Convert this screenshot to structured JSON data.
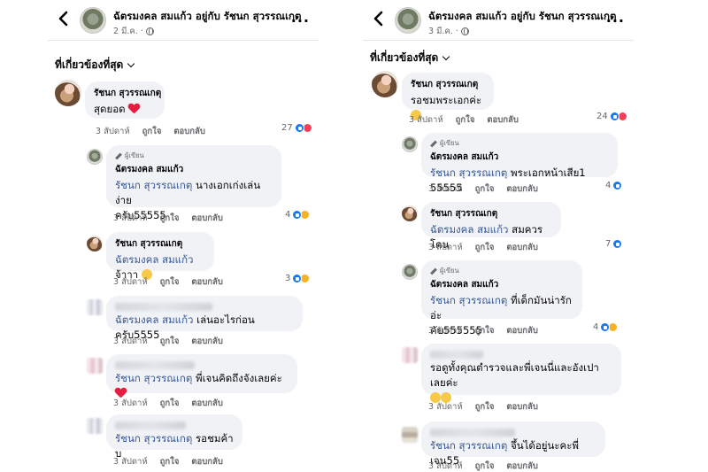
{
  "left": {
    "post": {
      "title": "ฉัตรมงคล สมแก้ว อยู่กับ รัชนก สุวรรณเกตุ",
      "meta": "2 มี.ค. ·"
    },
    "filter_label": "ที่เกี่ยวข้องที่สุด",
    "comments": [
      {
        "name": "รัชนก สุวรรณเกตุ",
        "text": "สุดยอด",
        "time": "3 สัปดาห์",
        "like": "ถูกใจ",
        "reply": "ตอบกลับ",
        "reaction_count": "27"
      },
      {
        "badge": "ผู้เขียน",
        "name": "ฉัตรมงคล สมแก้ว",
        "mention": "รัชนก สุวรรณเกตุ",
        "text": "นางเอกเก่งเล่นง่าย",
        "text2": "ครับ55555",
        "time": "3 สัปดาห์",
        "like": "ถูกใจ",
        "reply": "ตอบกลับ",
        "reaction_count": "4"
      },
      {
        "name": "รัชนก สุวรรณเกตุ",
        "mention": "ฉัตรมงคล สมแก้ว",
        "text": "จ้าาา",
        "time": "3 สัปดาห์",
        "like": "ถูกใจ",
        "reply": "ตอบกลับ",
        "reaction_count": "3"
      },
      {
        "mention": "ฉัตรมงคล สมแก้ว",
        "text": "เล่นอะไรก่อนครับ5555",
        "time": "3 สัปดาห์",
        "like": "ถูกใจ",
        "reply": "ตอบกลับ"
      },
      {
        "mention": "รัชนก สุวรรณเกตุ",
        "text": "พี่เจนคิดถึงจังเลยค่ะ",
        "time": "3 สัปดาห์",
        "like": "ถูกใจ",
        "reply": "ตอบกลับ"
      },
      {
        "mention": "รัชนก สุวรรณเกตุ",
        "text": "รอชมค้าบ",
        "time": "3 สัปดาห์",
        "like": "ถูกใจ",
        "reply": "ตอบกลับ"
      }
    ]
  },
  "right": {
    "post": {
      "title": "ฉัตรมงคล สมแก้ว อยู่กับ รัชนก สุวรรณเกตุ",
      "meta": "3 มี.ค. ·"
    },
    "filter_label": "ที่เกี่ยวข้องที่สุด",
    "comments": [
      {
        "name": "รัชนก สุวรรณเกตุ",
        "text": "รอชมพระเอกค่ะ",
        "time": "3 สัปดาห์",
        "like": "ถูกใจ",
        "reply": "ตอบกลับ",
        "reaction_count": "24"
      },
      {
        "badge": "ผู้เขียน",
        "name": "ฉัตรมงคล สมแก้ว",
        "mention": "รัชนก สุวรรณเกตุ",
        "text": "พระเอกหน้าเสีย1 55555",
        "time": "3 สัปดาห์",
        "like": "ถูกใจ",
        "reply": "ตอบกลับ",
        "reaction_count": "4"
      },
      {
        "name": "รัชนก สุวรรณเกตุ",
        "mention": "ฉัตรมงคล สมแก้ว",
        "text": "สมควรโดน",
        "time": "3 สัปดาห์",
        "like": "ถูกใจ",
        "reply": "ตอบกลับ",
        "reaction_count": "7"
      },
      {
        "badge": "ผู้เขียน",
        "name": "ฉัตรมงคล สมแก้ว",
        "mention": "รัชนก สุวรรณเกตุ",
        "text": "ที่เด็กมันน่ารักอ่ะ",
        "text2": "คับ555555",
        "time": "3 สัปดาห์",
        "like": "ถูกใจ",
        "reply": "ตอบกลับ",
        "reaction_count": "4"
      },
      {
        "text": "รอดูทั้งคุณตำรวจและพี่เจนนี่และอังเปาเลยค่ะ",
        "time": "3 สัปดาห์",
        "like": "ถูกใจ",
        "reply": "ตอบกลับ"
      },
      {
        "mention": "รัชนก สุวรรณเกตุ",
        "text": "จึ้นได้อยู่นะคะพี่เจน55",
        "time": "3 สัปดาห์",
        "like": "ถูกใจ",
        "reply": "ตอบกลับ"
      }
    ]
  }
}
